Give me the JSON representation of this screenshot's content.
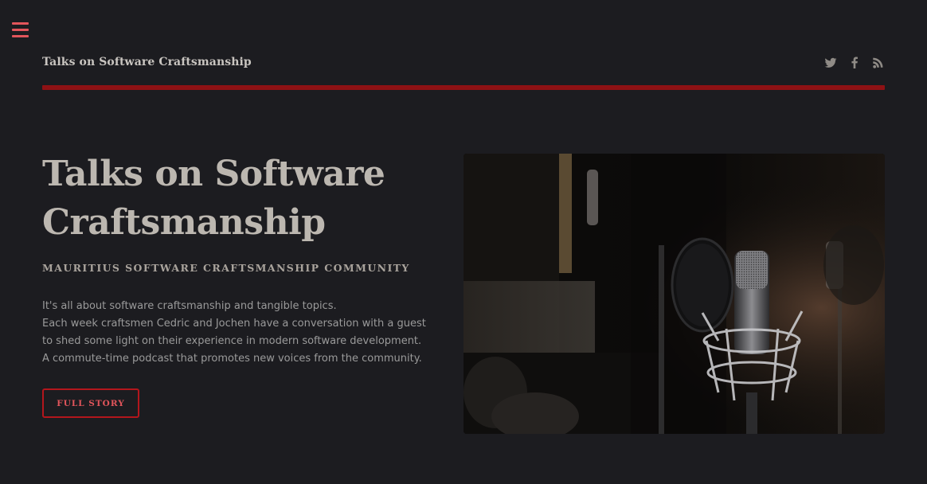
{
  "header": {
    "site_title": "Talks on Software Craftsmanship",
    "menu_icon": "hamburger-menu-icon",
    "social": [
      {
        "name": "twitter",
        "icon": "twitter-icon"
      },
      {
        "name": "facebook",
        "icon": "facebook-icon"
      },
      {
        "name": "rss",
        "icon": "rss-icon"
      }
    ]
  },
  "hero": {
    "title": "Talks on Software Craftsmanship",
    "subtitle": "MAURITIUS SOFTWARE CRAFTSMANSHIP COMMUNITY",
    "paragraph_1": "It's all about software craftsmanship and tangible topics.",
    "paragraph_2": "Each week craftsmen Cedric and Jochen have a conversation with a guest to shed some light on their experience in modern software development. A commute-time podcast that promotes new voices from the community.",
    "button_label": "FULL STORY",
    "image_subject": "studio microphone photo"
  },
  "colors": {
    "background": "#1c1c20",
    "accent": "#e2555b",
    "rule": "#8e1114",
    "button_border": "#b3161c",
    "title": "#bcb7b0"
  }
}
